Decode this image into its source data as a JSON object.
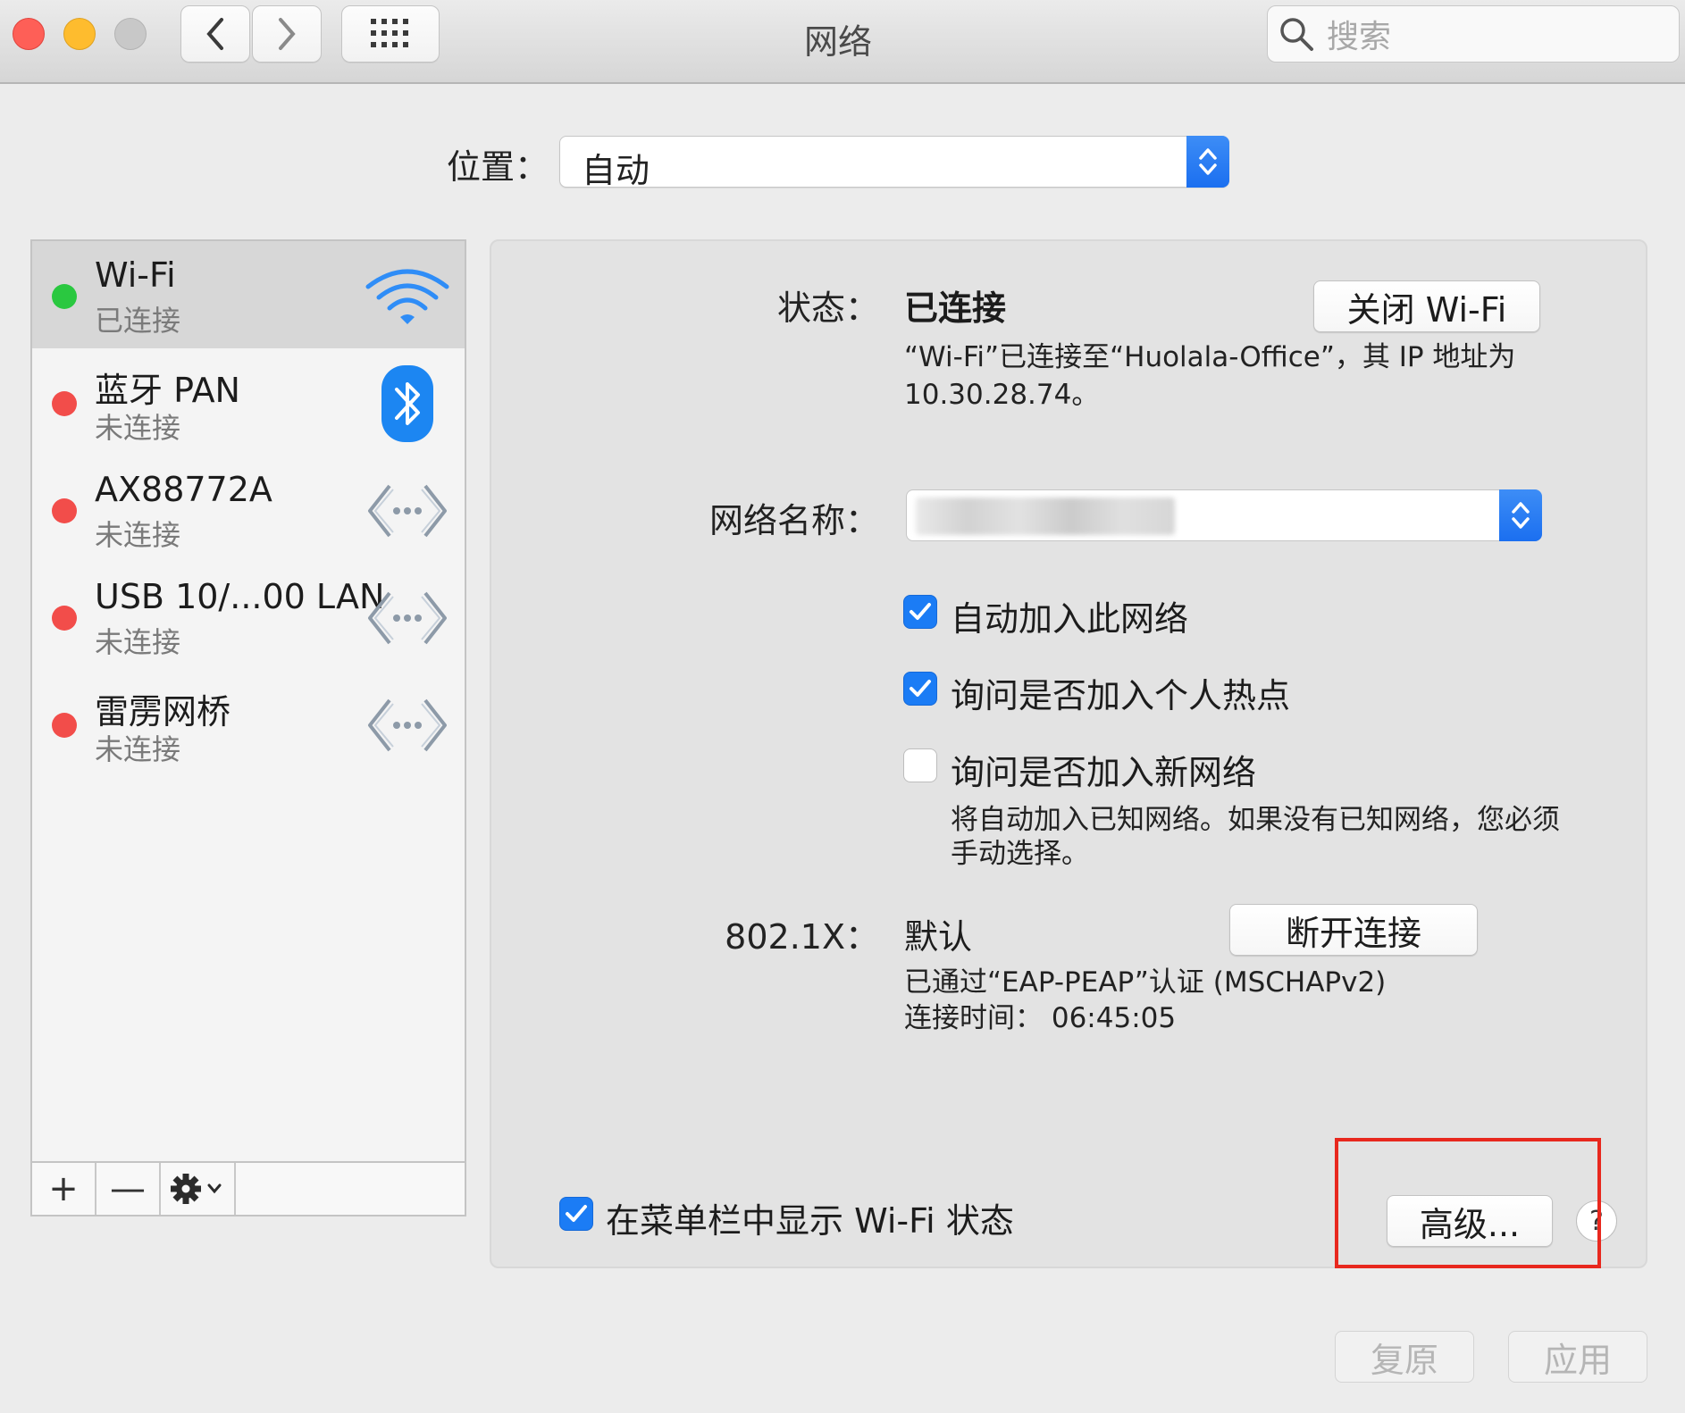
{
  "window": {
    "title": "网络",
    "search_placeholder": "搜索"
  },
  "location": {
    "label": "位置：",
    "value": "自动"
  },
  "services": [
    {
      "name": "Wi-Fi",
      "status": "已连接",
      "status_color": "#2ac840",
      "icon": "wifi-icon",
      "selected": true
    },
    {
      "name": "蓝牙 PAN",
      "status": "未连接",
      "status_color": "#f24d4a",
      "icon": "bluetooth-icon"
    },
    {
      "name": "AX88772A",
      "status": "未连接",
      "status_color": "#f24d4a",
      "icon": "ethernet-icon"
    },
    {
      "name": "USB 10/...00 LAN",
      "status": "未连接",
      "status_color": "#f24d4a",
      "icon": "ethernet-icon"
    },
    {
      "name": "雷雳网桥",
      "status": "未连接",
      "status_color": "#f24d4a",
      "icon": "ethernet-icon"
    }
  ],
  "list_toolbar": {
    "add": "+",
    "remove": "—"
  },
  "detail": {
    "status_label": "状态：",
    "status_value": "已连接",
    "turn_off_button": "关闭 Wi-Fi",
    "status_desc_line1": "“Wi-Fi”已连接至“Huolala-Office”，其 IP 地址为",
    "status_desc_line2": "10.30.28.74。",
    "network_name_label": "网络名称：",
    "auto_join": "自动加入此网络",
    "ask_hotspot": "询问是否加入个人热点",
    "ask_new_networks": "询问是否加入新网络",
    "hint_line1": "将自动加入已知网络。如果没有已知网络，您必须",
    "hint_line2": "手动选择。",
    "dot1x_label": "802.1X：",
    "dot1x_value": "默认",
    "disconnect_button": "断开连接",
    "auth_line": "已通过“EAP-PEAP”认证 (MSCHAPv2)",
    "connect_time": "连接时间：  06:45:05",
    "show_in_menubar": "在菜单栏中显示 Wi-Fi 状态",
    "advanced_button": "高级...",
    "help": "?"
  },
  "footer": {
    "revert_button": "复原",
    "apply_button": "应用"
  },
  "colors": {
    "accent": "#1b7cf5",
    "highlight": "#e8281e",
    "connected": "#2ac840",
    "disconnected": "#f24d4a"
  }
}
